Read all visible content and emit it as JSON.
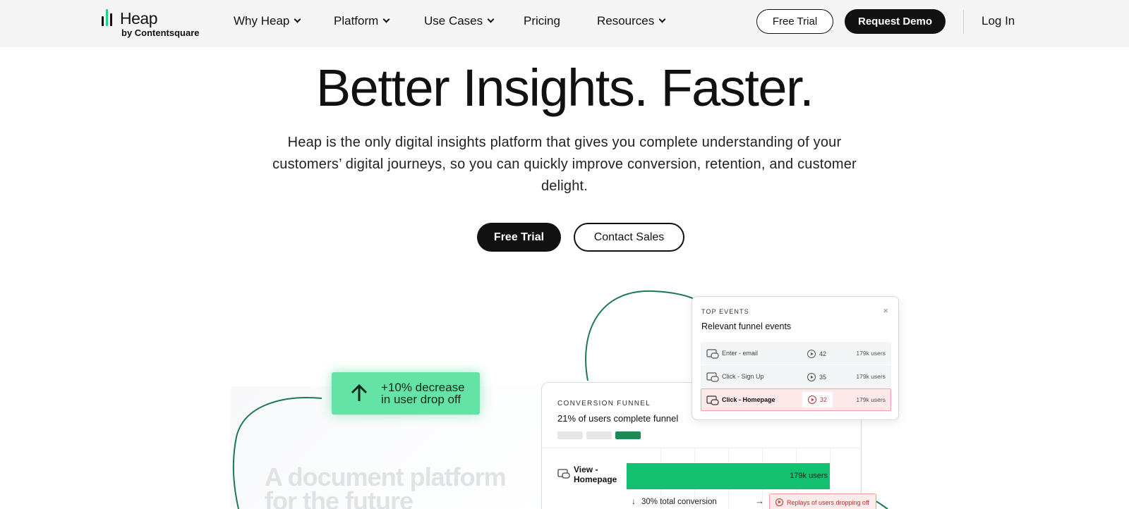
{
  "nav": {
    "logo": {
      "word": "Heap",
      "sub": "by Contentsquare"
    },
    "items": [
      {
        "label": "Why Heap",
        "dropdown": true
      },
      {
        "label": "Platform",
        "dropdown": true
      },
      {
        "label": "Use Cases",
        "dropdown": true
      },
      {
        "label": "Pricing",
        "dropdown": false
      },
      {
        "label": "Resources",
        "dropdown": true
      }
    ],
    "free_trial": "Free Trial",
    "request_demo": "Request Demo",
    "log_in": "Log In"
  },
  "hero": {
    "title": "Better Insights. Faster.",
    "subtitle": "Heap is the only digital insights platform that gives you complete understanding of your customers’ digital journeys, so you can quickly improve conversion, retention, and customer delight.",
    "primary_cta": "Free Trial",
    "secondary_cta": "Contact Sales"
  },
  "illustration": {
    "background_text": [
      "A document platform",
      "for the future"
    ],
    "stat": {
      "line1": "+10% decrease",
      "line2": "in user drop off",
      "icon": "arrow-up-icon"
    },
    "funnel": {
      "label": "CONVERSION FUNNEL",
      "title": "21% of users complete funnel",
      "step": {
        "name_line1": "View -",
        "name_line2": "Homepage",
        "value": "179k users",
        "fraction": 1.0
      },
      "conversion": "30% total conversion",
      "replay": "Replays of users dropping off"
    },
    "events": {
      "label": "TOP EVENTS",
      "title": "Relevant funnel events",
      "close": "×",
      "rows": [
        {
          "name": "Enter - email",
          "count": "42",
          "users": "179k users",
          "highlight": false
        },
        {
          "name": "Click - Sign Up",
          "count": "35",
          "users": "179k users",
          "highlight": false
        },
        {
          "name": "Click - Homepage",
          "count": "32",
          "users": "179k users",
          "highlight": true
        }
      ]
    }
  },
  "colors": {
    "brand_green": "#12c06f",
    "stat_green": "#63e3a6",
    "dark": "#111111",
    "nav_bg": "#f5f5f5",
    "alert_red": "#c23030",
    "curve": "#1b7a4e"
  }
}
